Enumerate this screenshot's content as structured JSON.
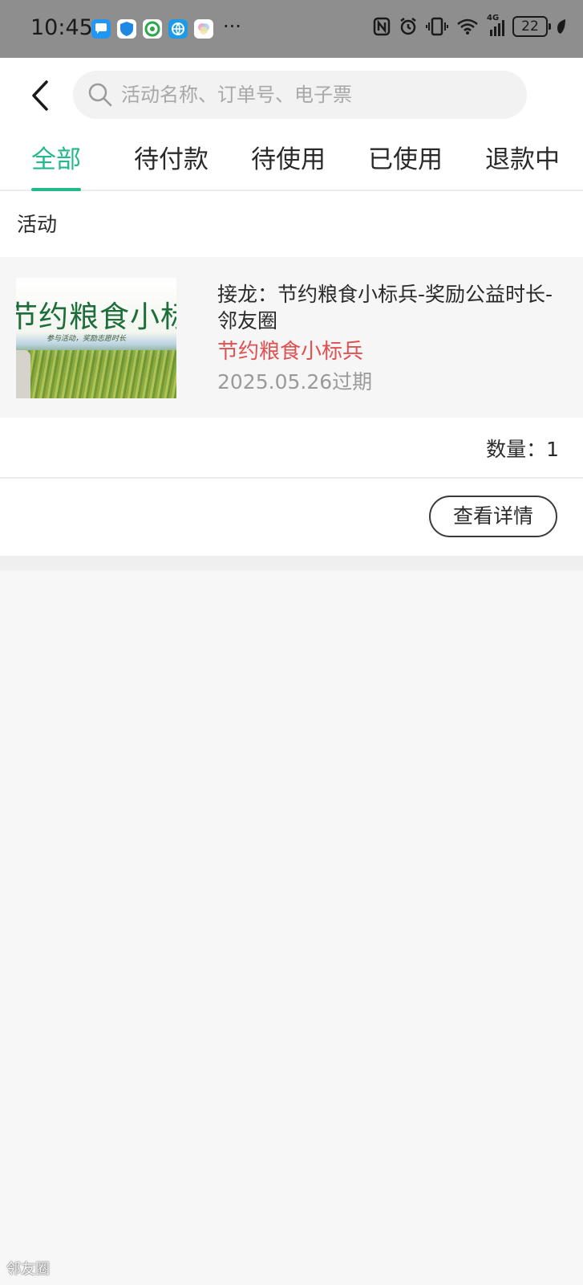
{
  "status_bar": {
    "time": "10:45",
    "more": "···",
    "battery": "22",
    "network": "4G",
    "app_icons": [
      "messages-icon",
      "shield-icon",
      "mobile-carrier-icon",
      "browser-icon",
      "gallery-icon"
    ],
    "right_icons": [
      "nfc-icon",
      "alarm-icon",
      "vibrate-icon",
      "wifi-icon",
      "signal-icon",
      "battery-icon",
      "leaf-icon"
    ]
  },
  "header": {
    "search_placeholder": "活动名称、订单号、电子票"
  },
  "tabs": [
    {
      "label": "全部",
      "active": true
    },
    {
      "label": "待付款",
      "active": false
    },
    {
      "label": "待使用",
      "active": false
    },
    {
      "label": "已使用",
      "active": false
    },
    {
      "label": "退款中",
      "active": false
    }
  ],
  "section": {
    "label": "活动"
  },
  "order": {
    "thumbnail": {
      "title": "节约粮食小标兵",
      "subtitle": "参与活动，奖励志愿时长"
    },
    "title": "接龙：节约粮食小标兵-奖励公益时长-邻友圈",
    "subtitle": "节约粮食小标兵",
    "expiry": "2025.05.26过期",
    "quantity": "数量：1",
    "detail_button": "查看详情"
  },
  "watermark": "邻友圈",
  "colors": {
    "accent": "#23b98b",
    "highlight_red": "#e05050",
    "status_bar_bg": "#8e8e8e"
  }
}
